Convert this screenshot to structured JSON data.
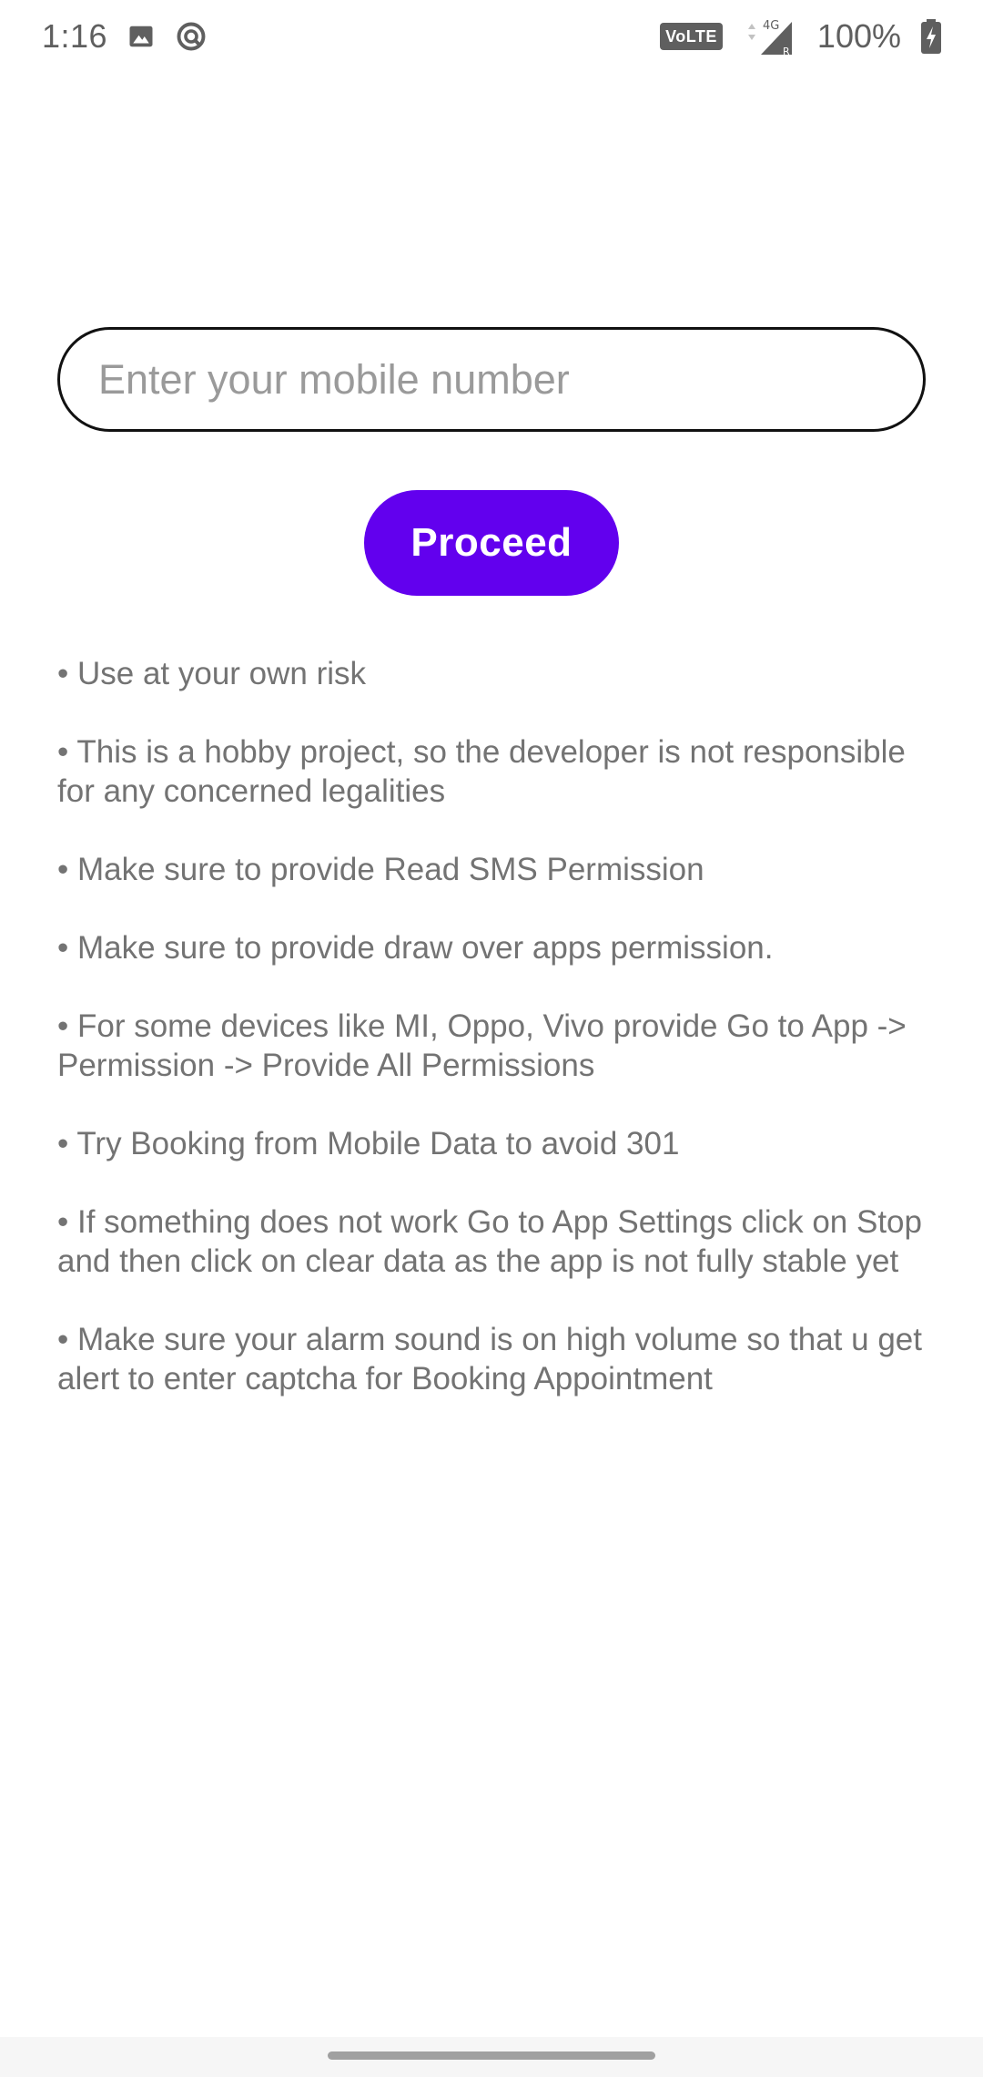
{
  "status_bar": {
    "time": "1:16",
    "left_icons": [
      "image-icon",
      "data-saver-icon"
    ],
    "volte_label": "VoLTE",
    "network_label": "4G",
    "roaming_label": "R",
    "battery_percent": "100%"
  },
  "form": {
    "mobile_input": {
      "placeholder": "Enter your mobile number",
      "value": ""
    },
    "proceed_label": "Proceed"
  },
  "notes": [
    "• Use at your own risk",
    "• This is a hobby project, so the developer is not responsible for any concerned legalities",
    "• Make sure to provide Read SMS Permission",
    "• Make sure to provide draw over apps permission.",
    "• For some devices like MI, Oppo, Vivo provide Go to App -> Permission -> Provide All Permissions",
    "• Try Booking from Mobile Data to avoid 301",
    "• If something does not work Go to App Settings click on Stop and then click on clear data as the app is not fully stable yet",
    "• Make sure your alarm sound is on high volume so that u get alert to enter captcha for Booking Appointment"
  ],
  "colors": {
    "accent": "#6200ee",
    "note_text": "#737373",
    "input_border": "#111111",
    "placeholder": "#9a9a9a"
  }
}
